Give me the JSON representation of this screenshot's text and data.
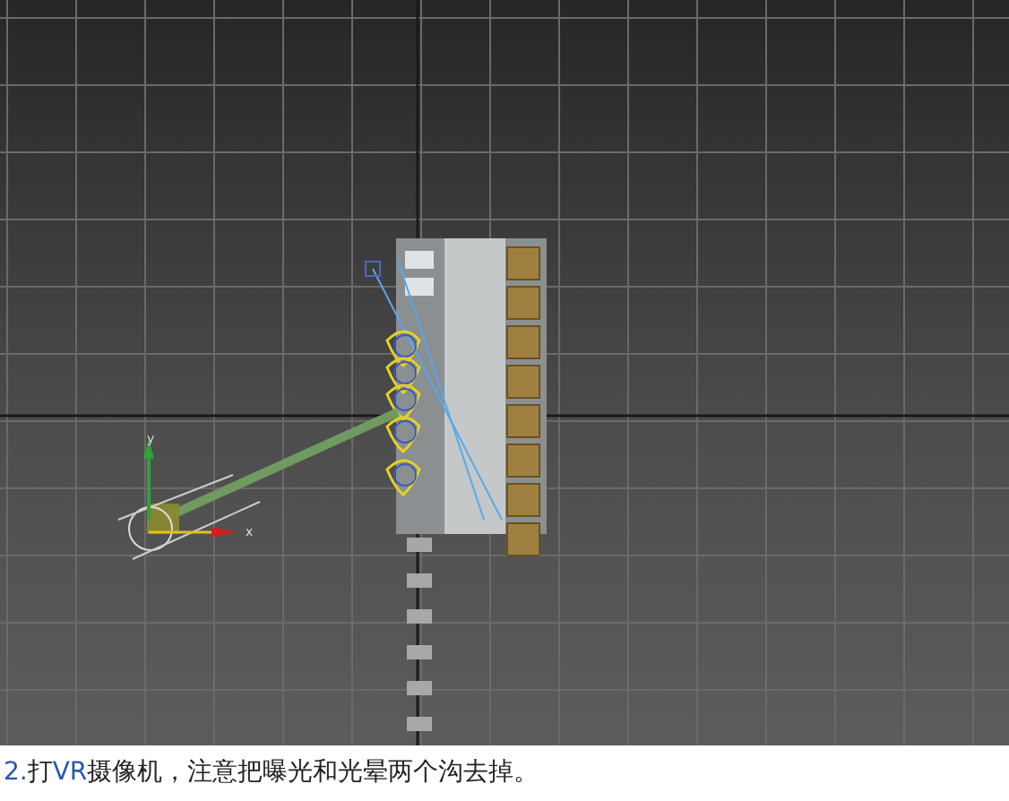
{
  "viewport": {
    "axis_labels": [
      "y",
      "x"
    ]
  },
  "caption": [
    {
      "text": "2.",
      "highlight": true
    },
    {
      "text": "打",
      "highlight": false
    },
    {
      "text": "VR",
      "highlight": true
    },
    {
      "text": "摄像机，注意把曝光和光晕两个沟去掉。",
      "highlight": false
    }
  ]
}
